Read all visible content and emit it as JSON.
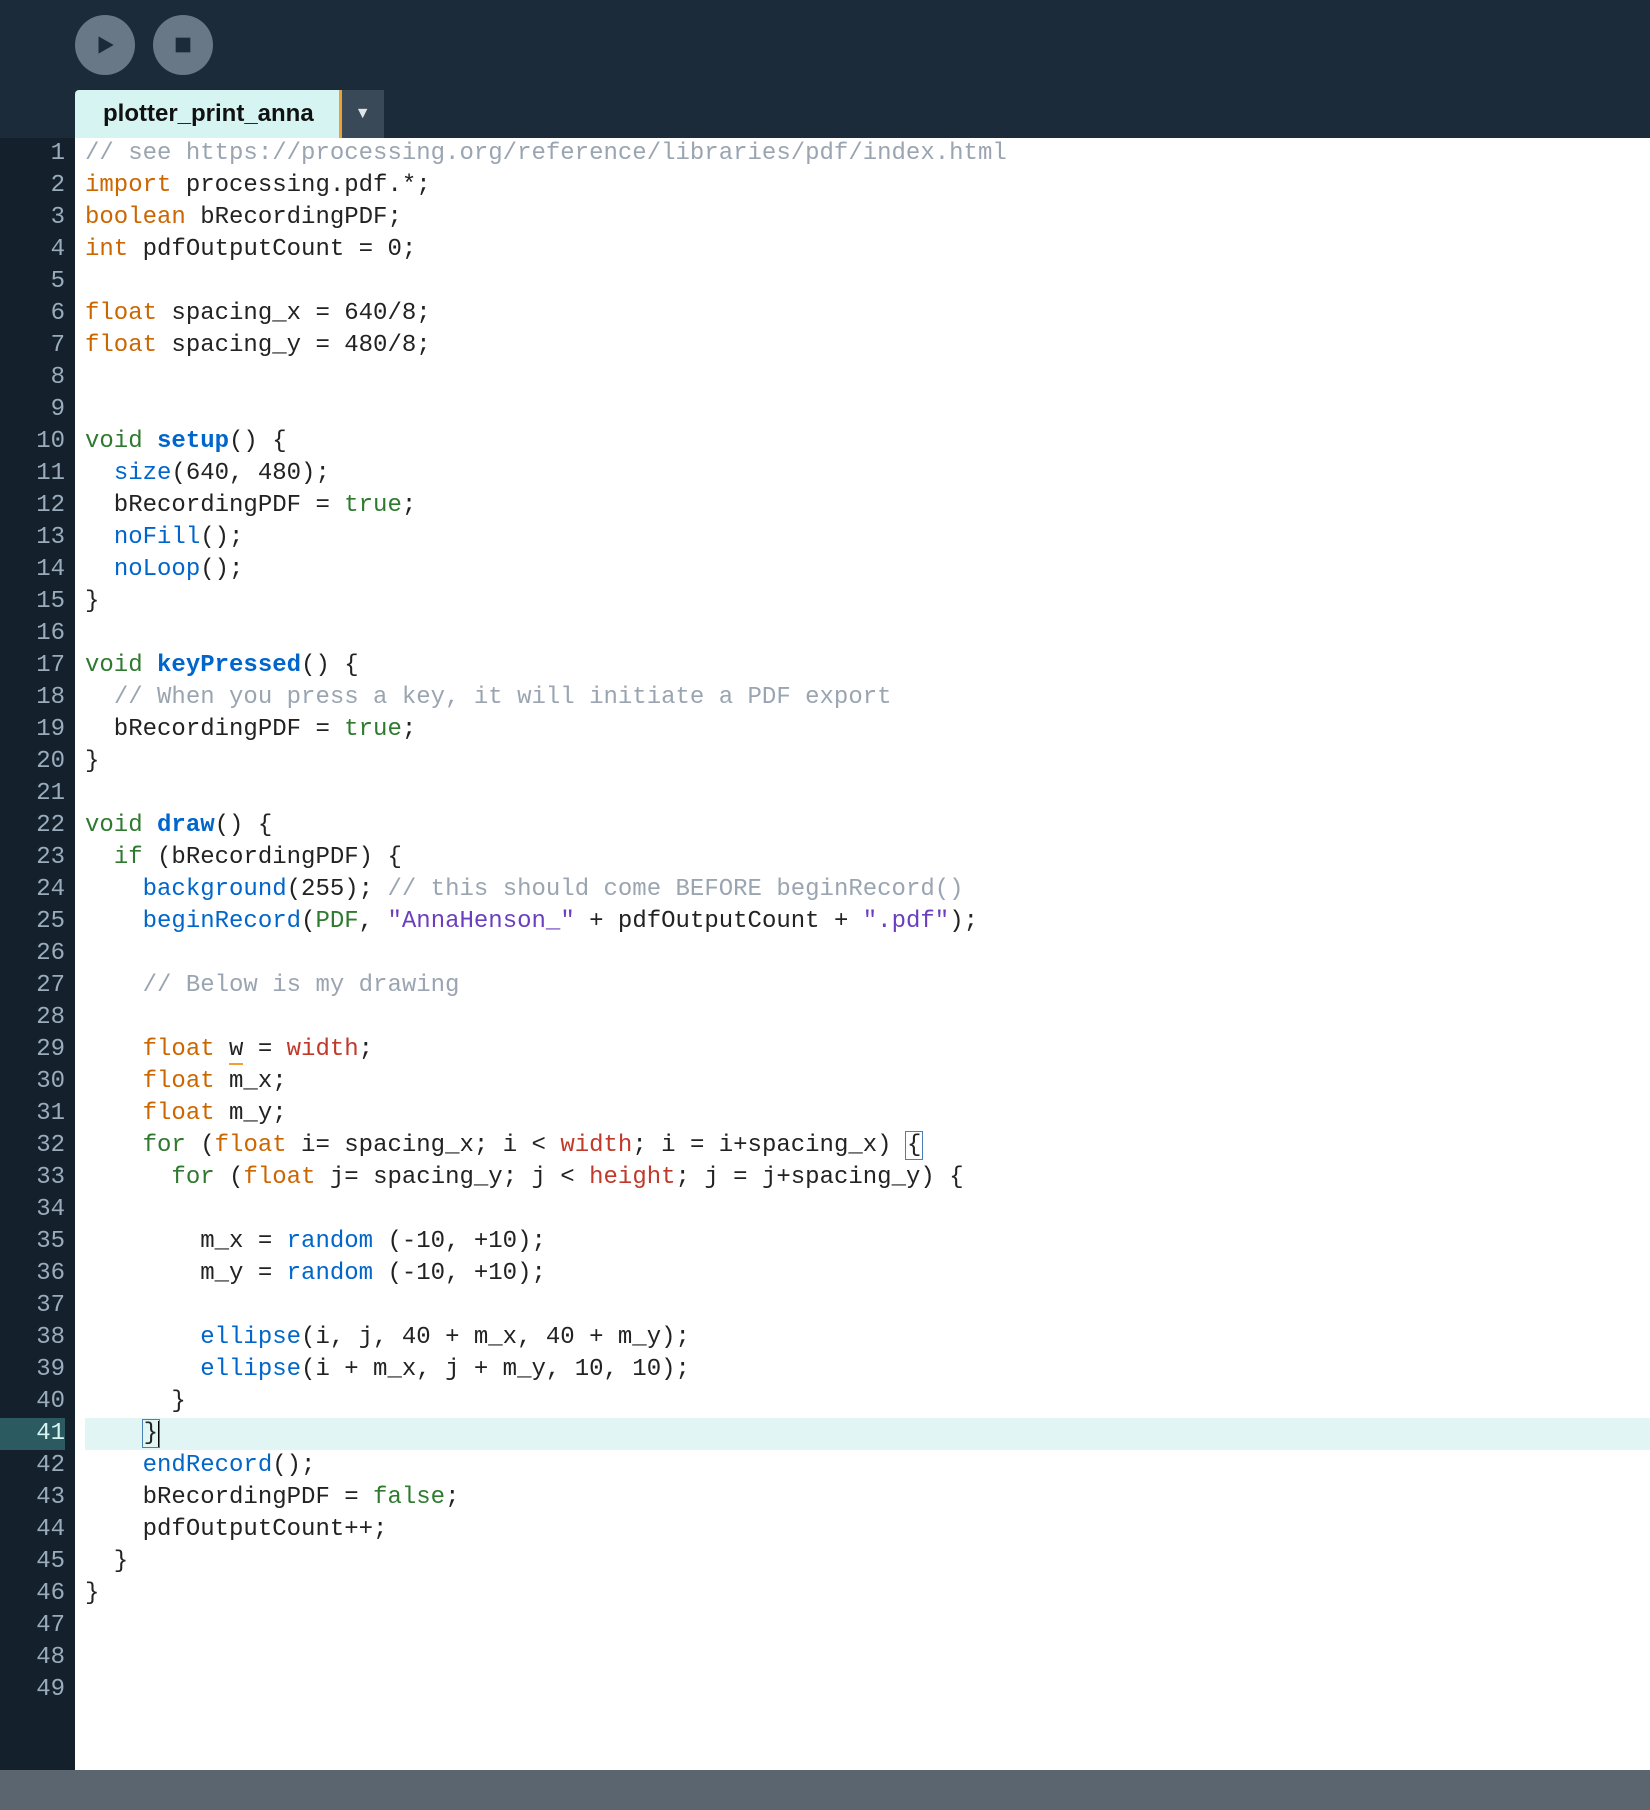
{
  "toolbar": {
    "run_icon": "run-icon",
    "stop_icon": "stop-icon"
  },
  "tabs": {
    "active_label": "plotter_print_anna",
    "dropdown_glyph": "▼"
  },
  "editor": {
    "highlighted_line": 41,
    "total_lines": 49,
    "lines": [
      {
        "n": 1,
        "tokens": [
          [
            "// see https://processing.org/reference/libraries/pdf/index.html",
            "c-comment"
          ]
        ]
      },
      {
        "n": 2,
        "tokens": [
          [
            "import",
            "c-type"
          ],
          [
            " processing.pdf.*;",
            ""
          ]
        ]
      },
      {
        "n": 3,
        "tokens": [
          [
            "boolean",
            "c-type"
          ],
          [
            " bRecordingPDF;",
            ""
          ]
        ]
      },
      {
        "n": 4,
        "tokens": [
          [
            "int",
            "c-type"
          ],
          [
            " pdfOutputCount = 0;",
            ""
          ]
        ]
      },
      {
        "n": 5,
        "tokens": []
      },
      {
        "n": 6,
        "tokens": [
          [
            "float",
            "c-type"
          ],
          [
            " spacing_x = 640/8;",
            ""
          ]
        ]
      },
      {
        "n": 7,
        "tokens": [
          [
            "float",
            "c-type"
          ],
          [
            " spacing_y = 480/8;",
            ""
          ]
        ]
      },
      {
        "n": 8,
        "tokens": []
      },
      {
        "n": 9,
        "tokens": []
      },
      {
        "n": 10,
        "tokens": [
          [
            "void",
            "c-kw"
          ],
          [
            " ",
            ""
          ],
          [
            "setup",
            "c-fn c-bold"
          ],
          [
            "() {",
            ""
          ]
        ]
      },
      {
        "n": 11,
        "tokens": [
          [
            "  ",
            ""
          ],
          [
            "size",
            "c-fn"
          ],
          [
            "(640, 480);",
            ""
          ]
        ]
      },
      {
        "n": 12,
        "tokens": [
          [
            "  bRecordingPDF = ",
            ""
          ],
          [
            "true",
            "c-kw"
          ],
          [
            ";",
            ""
          ]
        ]
      },
      {
        "n": 13,
        "tokens": [
          [
            "  ",
            ""
          ],
          [
            "noFill",
            "c-fn"
          ],
          [
            "();",
            ""
          ]
        ]
      },
      {
        "n": 14,
        "tokens": [
          [
            "  ",
            ""
          ],
          [
            "noLoop",
            "c-fn"
          ],
          [
            "();",
            ""
          ]
        ]
      },
      {
        "n": 15,
        "tokens": [
          [
            "}",
            ""
          ]
        ]
      },
      {
        "n": 16,
        "tokens": []
      },
      {
        "n": 17,
        "tokens": [
          [
            "void",
            "c-kw"
          ],
          [
            " ",
            ""
          ],
          [
            "keyPressed",
            "c-fn c-bold"
          ],
          [
            "() {",
            ""
          ]
        ]
      },
      {
        "n": 18,
        "tokens": [
          [
            "  ",
            ""
          ],
          [
            "// When you press a key, it will initiate a PDF export",
            "c-comment"
          ]
        ]
      },
      {
        "n": 19,
        "tokens": [
          [
            "  bRecordingPDF = ",
            ""
          ],
          [
            "true",
            "c-kw"
          ],
          [
            ";",
            ""
          ]
        ]
      },
      {
        "n": 20,
        "tokens": [
          [
            "}",
            ""
          ]
        ]
      },
      {
        "n": 21,
        "tokens": []
      },
      {
        "n": 22,
        "tokens": [
          [
            "void",
            "c-kw"
          ],
          [
            " ",
            ""
          ],
          [
            "draw",
            "c-fn c-bold"
          ],
          [
            "() {",
            ""
          ]
        ]
      },
      {
        "n": 23,
        "tokens": [
          [
            "  ",
            ""
          ],
          [
            "if",
            "c-kw"
          ],
          [
            " (bRecordingPDF) {",
            ""
          ]
        ]
      },
      {
        "n": 24,
        "tokens": [
          [
            "    ",
            ""
          ],
          [
            "background",
            "c-fn"
          ],
          [
            "(255); ",
            ""
          ],
          [
            "// this should come BEFORE beginRecord()",
            "c-comment"
          ]
        ]
      },
      {
        "n": 25,
        "tokens": [
          [
            "    ",
            ""
          ],
          [
            "beginRecord",
            "c-fn"
          ],
          [
            "(",
            ""
          ],
          [
            "PDF",
            "c-kw"
          ],
          [
            ", ",
            ""
          ],
          [
            "\"AnnaHenson_\"",
            "c-str"
          ],
          [
            " + pdfOutputCount + ",
            ""
          ],
          [
            "\".pdf\"",
            "c-str"
          ],
          [
            ");",
            ""
          ]
        ]
      },
      {
        "n": 26,
        "tokens": []
      },
      {
        "n": 27,
        "tokens": [
          [
            "    ",
            ""
          ],
          [
            "// Below is my drawing",
            "c-comment"
          ]
        ]
      },
      {
        "n": 28,
        "tokens": []
      },
      {
        "n": 29,
        "tokens": [
          [
            "    ",
            ""
          ],
          [
            "float",
            "c-type"
          ],
          [
            " ",
            ""
          ],
          [
            "w",
            "c-underline"
          ],
          [
            " = ",
            ""
          ],
          [
            "width",
            "c-builtin"
          ],
          [
            ";",
            ""
          ]
        ]
      },
      {
        "n": 30,
        "tokens": [
          [
            "    ",
            ""
          ],
          [
            "float",
            "c-type"
          ],
          [
            " m_x;",
            ""
          ]
        ]
      },
      {
        "n": 31,
        "tokens": [
          [
            "    ",
            ""
          ],
          [
            "float",
            "c-type"
          ],
          [
            " m_y;",
            ""
          ]
        ]
      },
      {
        "n": 32,
        "tokens": [
          [
            "    ",
            ""
          ],
          [
            "for",
            "c-kw"
          ],
          [
            " (",
            ""
          ],
          [
            "float",
            "c-type"
          ],
          [
            " i= spacing_x; i < ",
            ""
          ],
          [
            "width",
            "c-builtin"
          ],
          [
            "; i = i+spacing_x) ",
            ""
          ],
          [
            "{",
            "c-bracket-match"
          ]
        ]
      },
      {
        "n": 33,
        "tokens": [
          [
            "      ",
            ""
          ],
          [
            "for",
            "c-kw"
          ],
          [
            " (",
            ""
          ],
          [
            "float",
            "c-type"
          ],
          [
            " j= spacing_y; j < ",
            ""
          ],
          [
            "height",
            "c-builtin"
          ],
          [
            "; j = j+spacing_y) {",
            ""
          ]
        ]
      },
      {
        "n": 34,
        "tokens": []
      },
      {
        "n": 35,
        "tokens": [
          [
            "        m_x = ",
            ""
          ],
          [
            "random",
            "c-fn"
          ],
          [
            " (-10, +10);",
            ""
          ]
        ]
      },
      {
        "n": 36,
        "tokens": [
          [
            "        m_y = ",
            ""
          ],
          [
            "random",
            "c-fn"
          ],
          [
            " (-10, +10);",
            ""
          ]
        ]
      },
      {
        "n": 37,
        "tokens": []
      },
      {
        "n": 38,
        "tokens": [
          [
            "        ",
            ""
          ],
          [
            "ellipse",
            "c-fn"
          ],
          [
            "(i, j, 40 + m_x, 40 + m_y);",
            ""
          ]
        ]
      },
      {
        "n": 39,
        "tokens": [
          [
            "        ",
            ""
          ],
          [
            "ellipse",
            "c-fn"
          ],
          [
            "(i + m_x, j + m_y, 10, 10);",
            ""
          ]
        ]
      },
      {
        "n": 40,
        "tokens": [
          [
            "      }",
            ""
          ]
        ]
      },
      {
        "n": 41,
        "tokens": [
          [
            "    ",
            ""
          ],
          [
            "}",
            "c-bracket-match"
          ],
          [
            "|",
            "caret-marker"
          ]
        ]
      },
      {
        "n": 42,
        "tokens": [
          [
            "    ",
            ""
          ],
          [
            "endRecord",
            "c-fn"
          ],
          [
            "();",
            ""
          ]
        ]
      },
      {
        "n": 43,
        "tokens": [
          [
            "    bRecordingPDF = ",
            ""
          ],
          [
            "false",
            "c-kw"
          ],
          [
            ";",
            ""
          ]
        ]
      },
      {
        "n": 44,
        "tokens": [
          [
            "    pdfOutputCount++;",
            ""
          ]
        ]
      },
      {
        "n": 45,
        "tokens": [
          [
            "  }",
            ""
          ]
        ]
      },
      {
        "n": 46,
        "tokens": [
          [
            "}",
            ""
          ]
        ]
      },
      {
        "n": 47,
        "tokens": []
      },
      {
        "n": 48,
        "tokens": []
      },
      {
        "n": 49,
        "tokens": []
      }
    ]
  }
}
